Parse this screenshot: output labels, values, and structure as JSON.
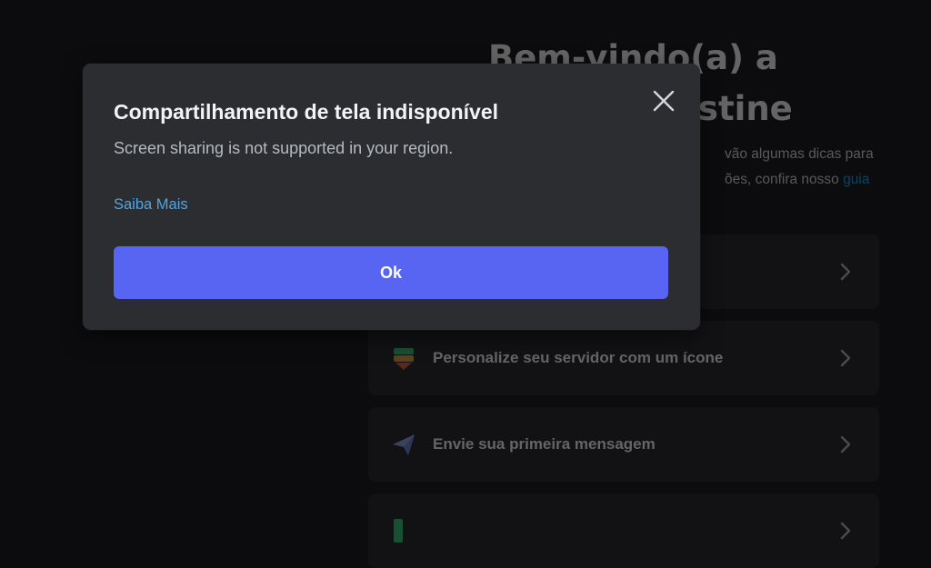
{
  "background": {
    "welcome_title_line1": "Bem-vindo(a) a",
    "welcome_title_line2": "ristine",
    "welcome_desc_line1": "vão algumas dicas para",
    "welcome_desc_line2": "ões, confira nosso ",
    "welcome_guide_link": "guia",
    "cards": [
      {
        "label": "",
        "icon": "invite-icon"
      },
      {
        "label": "Personalize seu servidor com um ícone",
        "icon": "server-icon"
      },
      {
        "label": "Envie sua primeira mensagem",
        "icon": "paper-plane-icon"
      },
      {
        "label": "",
        "icon": "app-icon"
      }
    ]
  },
  "modal": {
    "title": "Compartilhamento de tela indisponível",
    "body": "Screen sharing is not supported in your region.",
    "learn_more": "Saiba Mais",
    "ok_label": "Ok",
    "close_icon": "close-icon"
  },
  "colors": {
    "accent": "#5865f2",
    "link": "#00a8fc",
    "modal_bg": "#2b2d31",
    "page_bg": "#0c0c0e"
  }
}
